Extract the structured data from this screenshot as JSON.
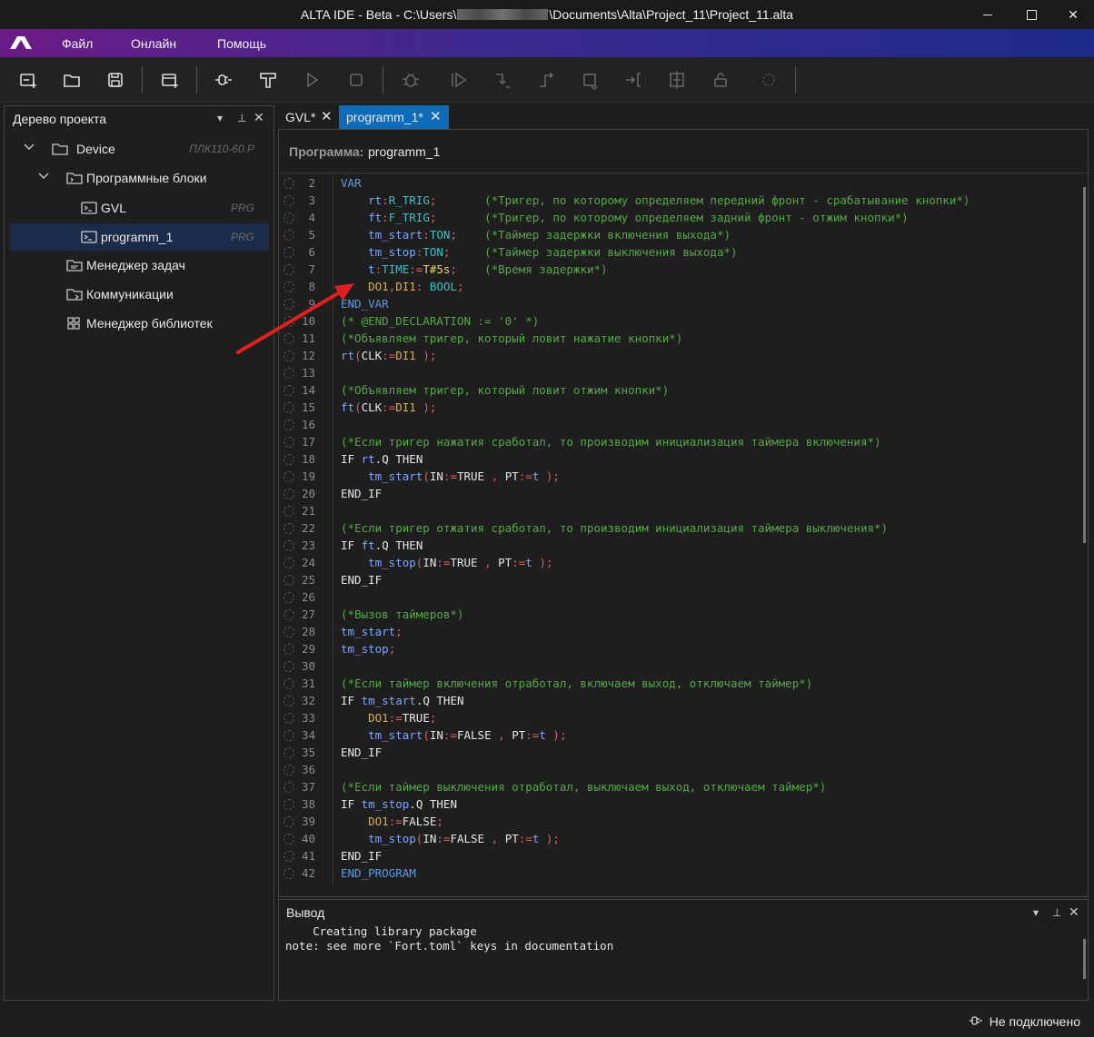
{
  "window": {
    "title_prefix": "ALTA IDE - Beta - C:\\Users\\",
    "title_suffix": "\\Documents\\Alta\\Project_11\\Project_11.alta",
    "close": "✕"
  },
  "menu": {
    "file": "Файл",
    "online": "Онлайн",
    "help": "Помощь"
  },
  "toolbar": {
    "icons": [
      "new-item-icon",
      "open-folder-icon",
      "save-icon",
      "add-device-icon",
      "connect-icon",
      "build-icon",
      "run-icon",
      "stop-icon",
      "debug-icon",
      "step-run-icon",
      "step-into-icon",
      "step-over-icon",
      "step-out-icon",
      "run-to-cursor-icon",
      "breakpoint-icon",
      "unlock-icon",
      "spinner-icon"
    ]
  },
  "project_tree": {
    "title": "Дерево проекта",
    "device": {
      "label": "Device",
      "type": "ПЛК110-60.Р"
    },
    "program_blocks": "Программные блоки",
    "gvl": {
      "label": "GVL",
      "type": "PRG"
    },
    "programm_1": {
      "label": "programm_1",
      "type": "PRG"
    },
    "task_manager": "Менеджер задач",
    "communications": "Коммуникации",
    "library_manager": "Менеджер библиотек"
  },
  "tabs": [
    {
      "label": "GVL*",
      "close": "✕"
    },
    {
      "label": "programm_1*",
      "close": "✕"
    }
  ],
  "editor": {
    "header_key": "Программа:",
    "header_value": "programm_1",
    "lines": [
      {
        "n": "2",
        "t": "VAR"
      },
      {
        "n": "3",
        "t": "    rt:R_TRIG;       (*Тригер, по которому определяем передний фронт - срабатывание кнопки*)"
      },
      {
        "n": "4",
        "t": "    ft:F_TRIG;       (*Тригер, по которому определяем задний фронт - отжим кнопки*)"
      },
      {
        "n": "5",
        "t": "    tm_start:TON;    (*Таймер задержки включения выхода*)"
      },
      {
        "n": "6",
        "t": "    tm_stop:TON;     (*Таймер задержки выключения выхода*)"
      },
      {
        "n": "7",
        "t": "    t:TIME:=T#5s;    (*Время задержки*)"
      },
      {
        "n": "8",
        "t": "    DO1,DI1: BOOL;"
      },
      {
        "n": "9",
        "t": "END_VAR"
      },
      {
        "n": "10",
        "t": "(* @END_DECLARATION := '0' *)"
      },
      {
        "n": "11",
        "t": "(*Объявляем тригер, который ловит нажатие кнопки*)"
      },
      {
        "n": "12",
        "t": "rt(CLK:=DI1 );"
      },
      {
        "n": "13",
        "t": ""
      },
      {
        "n": "14",
        "t": "(*Объявляем тригер, который ловит отжим кнопки*)"
      },
      {
        "n": "15",
        "t": "ft(CLK:=DI1 );"
      },
      {
        "n": "16",
        "t": ""
      },
      {
        "n": "17",
        "t": "(*Если тригер нажатия сработал, то производим инициализация таймера включения*)"
      },
      {
        "n": "18",
        "t": "IF rt.Q THEN"
      },
      {
        "n": "19",
        "t": "    tm_start(IN:=TRUE , PT:=t );"
      },
      {
        "n": "20",
        "t": "END_IF"
      },
      {
        "n": "21",
        "t": ""
      },
      {
        "n": "22",
        "t": "(*Если тригер отжатия сработал, то производим инициализация таймера выключения*)"
      },
      {
        "n": "23",
        "t": "IF ft.Q THEN"
      },
      {
        "n": "24",
        "t": "    tm_stop(IN:=TRUE , PT:=t );"
      },
      {
        "n": "25",
        "t": "END_IF"
      },
      {
        "n": "26",
        "t": ""
      },
      {
        "n": "27",
        "t": "(*Вызов таймеров*)"
      },
      {
        "n": "28",
        "t": "tm_start;"
      },
      {
        "n": "29",
        "t": "tm_stop;"
      },
      {
        "n": "30",
        "t": ""
      },
      {
        "n": "31",
        "t": "(*Если таймер включения отработал, включаем выход, отключаем таймер*)"
      },
      {
        "n": "32",
        "t": "IF tm_start.Q THEN"
      },
      {
        "n": "33",
        "t": "    DO1:=TRUE;"
      },
      {
        "n": "34",
        "t": "    tm_start(IN:=FALSE , PT:=t );"
      },
      {
        "n": "35",
        "t": "END_IF"
      },
      {
        "n": "36",
        "t": ""
      },
      {
        "n": "37",
        "t": "(*Если таймер выключения отработал, выключаем выход, отключаем таймер*)"
      },
      {
        "n": "38",
        "t": "IF tm_stop.Q THEN"
      },
      {
        "n": "39",
        "t": "    DO1:=FALSE;"
      },
      {
        "n": "40",
        "t": "    tm_stop(IN:=FALSE , PT:=t );"
      },
      {
        "n": "41",
        "t": "END_IF"
      },
      {
        "n": "42",
        "t": "END_PROGRAM"
      }
    ]
  },
  "output": {
    "title": "Вывод",
    "line1": "    Creating library package",
    "line2": "note: see more `Fort.toml` keys in documentation"
  },
  "status": {
    "connection": "Не подключено"
  },
  "colors": {
    "menubar_start": "#6b1a86",
    "menubar_end": "#1d2a8a",
    "active_tab": "#0e6bb8",
    "selected_row": "#1b2b4a",
    "annotation_arrow": "#e02020",
    "keyword": "#5a9ae6",
    "comment": "#57a64a",
    "type": "#3cc0c8"
  }
}
